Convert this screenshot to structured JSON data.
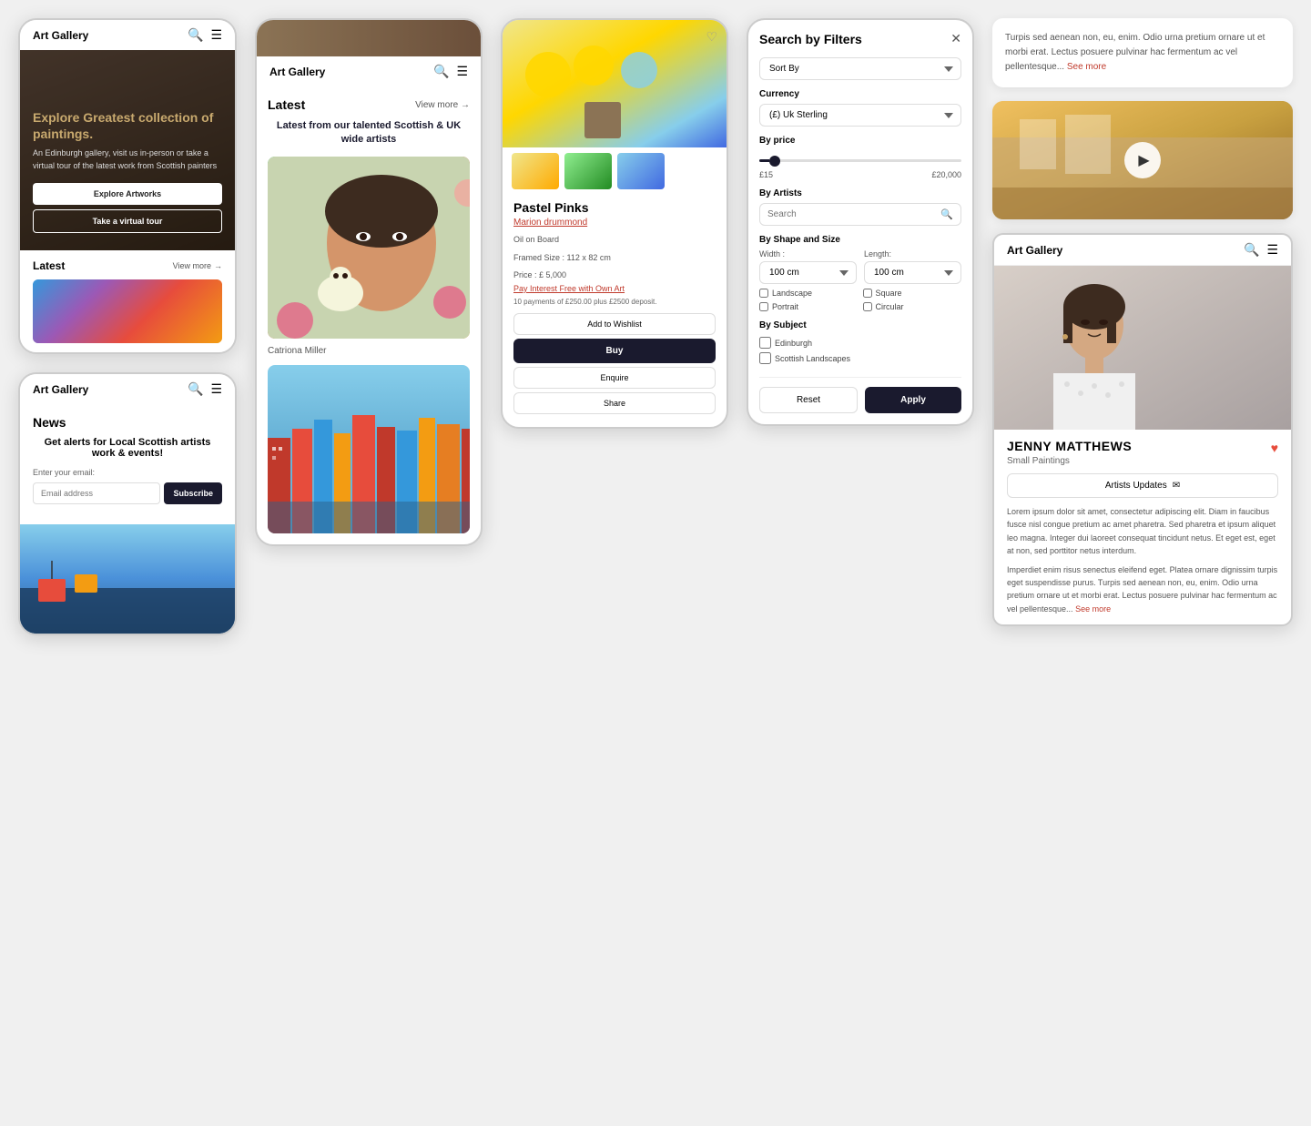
{
  "app": {
    "title": "Art Gallery"
  },
  "phone1": {
    "header": {
      "title": "Art Gallery",
      "icons": [
        "🔍",
        "☰"
      ]
    },
    "hero": {
      "title_plain": "Explore ",
      "title_accent": "Greatest collection",
      "title_end": " of paintings.",
      "subtitle": "An Edinburgh gallery, visit us in-person or take a virtual tour of the latest work from Scottish painters",
      "btn1": "Explore Artworks",
      "btn2": "Take a virtual tour"
    },
    "latest": {
      "title": "Latest",
      "view_more": "View more"
    }
  },
  "phone2_news": {
    "header": {
      "title": "Art Gallery",
      "icons": [
        "🔍",
        "☰"
      ]
    },
    "news": {
      "heading": "News",
      "subheading": "Get alerts for Local Scottish artists work & events!",
      "email_label": "Enter your email:",
      "email_placeholder": "Email address",
      "subscribe_btn": "Subscribe"
    }
  },
  "phone3_gallery": {
    "header": {
      "title": "Art Gallery",
      "icons": [
        "🔍",
        "☰"
      ]
    },
    "gallery": {
      "latest_label": "Latest",
      "view_more": "View more",
      "subtitle": "Latest from our talented Scottish & UK wide artists",
      "artist_name": "Catriona Miller"
    }
  },
  "phone4_product": {
    "product": {
      "title": "Pastel Pinks",
      "artist": "Marion drummond",
      "medium": "Oil on Board",
      "framed_size": "Framed Size :  112 x 82 cm",
      "price": "Price :  £ 5,000",
      "pay_interest": "Pay Interest Free with Own Art",
      "payments_info": "10 payments of  £250.00 plus  £2500 deposit.",
      "btn_wishlist": "Add to Wishlist",
      "btn_buy": "Buy",
      "btn_enquire": "Enquire",
      "btn_share": "Share"
    }
  },
  "phone5_filters": {
    "title": "Search by Filters",
    "sort_by_label": "Sort By",
    "currency_label": "Currency",
    "currency_value": "(£) Uk Sterling",
    "price_label": "By price",
    "price_min": "£15",
    "price_max": "£20,000",
    "artists_label": "By Artists",
    "artists_placeholder": "Search",
    "shape_label": "By Shape and Size",
    "width_label": "Width :",
    "width_value": "100 cm",
    "length_label": "Length:",
    "length_value": "100 cm",
    "shapes": [
      "Landscape",
      "Square",
      "Portrait",
      "Circular"
    ],
    "subject_label": "By Subject",
    "subjects": [
      "Edinburgh",
      "Scottish Landscapes"
    ],
    "btn_reset": "Reset",
    "btn_apply": "Apply",
    "search_label": "search",
    "see_more": "See more"
  },
  "right_col": {
    "text_card": {
      "body": "Turpis sed aenean non, eu, enim. Odio urna pretium ornare ut et morbi erat. Lectus posuere pulvinar hac fermentum ac vel pellentesque...",
      "see_more": "See more"
    },
    "artist_card": {
      "app_title": "Art Gallery",
      "icons": [
        "🔍",
        "☰"
      ],
      "artist_name": "JENNY MATTHEWS",
      "specialty": "Small Paintings",
      "updates_btn": "Artists Updates",
      "bio1": "Lorem ipsum dolor sit amet, consectetur adipiscing elit. Diam in faucibus fusce nisl congue pretium ac amet pharetra. Sed pharetra et ipsum aliquet leo magna. Integer dui laoreet consequat tincidunt netus. Et eget est, eget at non, sed porttitor netus interdum.",
      "bio2": "Imperdiet enim risus senectus eleifend eget. Platea ornare dignissim turpis eget suspendisse purus. Turpis sed aenean non, eu, enim. Odio urna pretium ornare ut et morbi erat. Lectus posuere pulvinar hac fermentum ac vel pellentesque...",
      "see_more": "See more"
    }
  }
}
